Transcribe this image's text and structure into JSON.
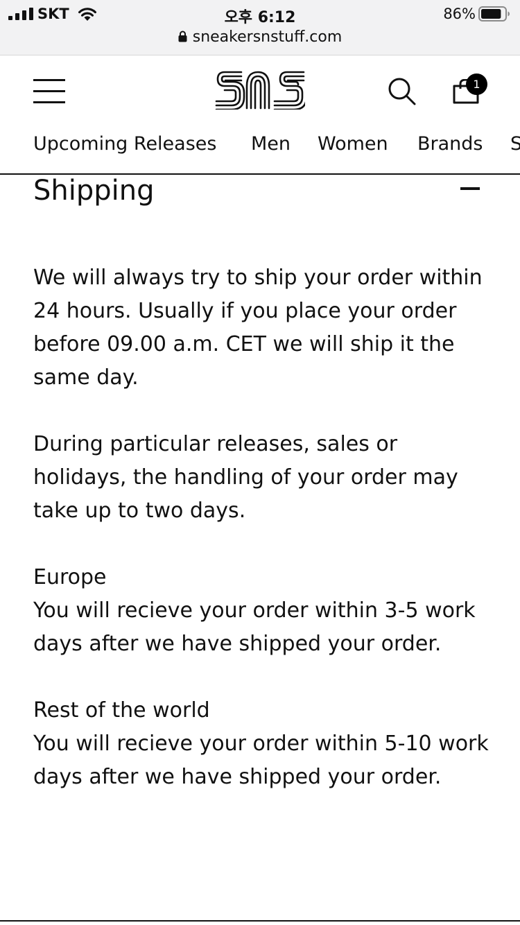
{
  "status_bar": {
    "carrier": "SKT",
    "time": "오후 6:12",
    "battery_percent": "86%",
    "battery_level": 0.86
  },
  "browser": {
    "url": "sneakersnstuff.com"
  },
  "header": {
    "logo_text": "SNS",
    "cart_count": "1"
  },
  "nav": {
    "items": [
      "Upcoming Releases",
      "Men",
      "Women",
      "Brands",
      "S"
    ]
  },
  "section": {
    "title": "Shipping",
    "paragraphs": [
      "We will always try to ship your order within 24 hours. Usually if you place your order before 09.00 a.m. CET we will ship it the same day.",
      "During particular releases, sales or holidays, the handling of your order may take up to two days."
    ],
    "regions": [
      {
        "name": "Europe",
        "text": "You will recieve your order within 3-5 work days after we have shipped your order."
      },
      {
        "name": "Rest of the world",
        "text": "You will recieve your order within 5-10 work days after we have shipped your order."
      }
    ]
  }
}
